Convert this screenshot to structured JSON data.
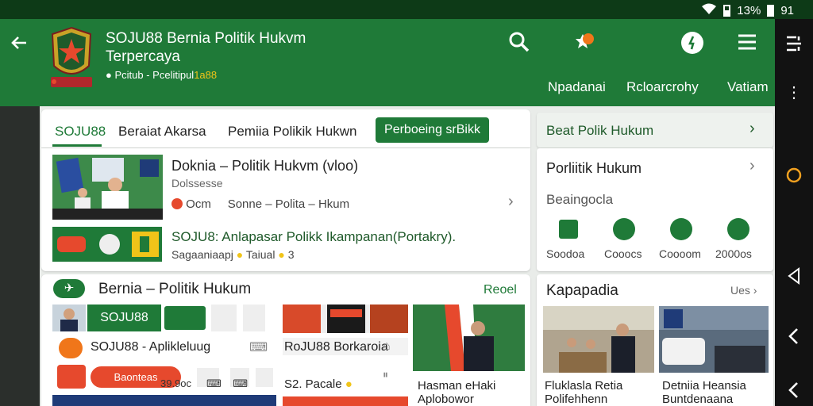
{
  "statusbar": {
    "battery_text": "13%",
    "signal_text": "91"
  },
  "header": {
    "title": "SOJU88 Bernia Politik Hukvm Terpercaya",
    "subtitle_prefix": "Pcitub - Pcelitipul",
    "subtitle_num": "1a88",
    "nav": [
      "Npadanai",
      "Rcloarcrohy",
      "Vatiam"
    ]
  },
  "tabs": [
    "SOJU88",
    "Beraiat Akarsa",
    "Pemiia Polikik Hukwn"
  ],
  "tab_button": "Perboeing srBikk",
  "news_list": [
    {
      "title": "Doknia – Politik Hukvm (vloo)",
      "sub": "Dolssesse",
      "meta1": "Ocm",
      "meta2": "Sonne – Polita – Hkum"
    },
    {
      "title": "SOJU8: Anlapasar Polikk Ikampanan(Portakry).",
      "meta": "Sagaaniaapj",
      "meta_b": "Taiual",
      "meta_c": "3"
    }
  ],
  "sidebar": {
    "top_link": "Beat Polik Hukum",
    "panel_title": "Porliitik Hukum",
    "panel_sub": "Beaingocla",
    "stats": [
      "Soodoa",
      "Cooocs",
      "Coooom",
      "2000os"
    ]
  },
  "section": {
    "title": "Bernia – Politik Hukum",
    "action": "Reoel"
  },
  "grid_items": {
    "soju_label": "SOJU88",
    "apk_title": "SOJU88 - Aplikleluug",
    "apk_button": "Baonteas",
    "apk_price": "39.9oc",
    "product_title": "RoJU88 Borkaroia",
    "product_price": "S2. Pacale",
    "news_a": "Hasman eHaki Aplobowor",
    "news_b_title": "Fluklasla Retia Polifehhenn",
    "news_c_title": "Detniia Heansia Buntdenaana"
  },
  "side_section": {
    "title": "Kapapadia",
    "more": "Ues"
  },
  "colors": {
    "primary": "#1f7a38",
    "accent": "#f0c419",
    "alert": "#e6492d"
  }
}
